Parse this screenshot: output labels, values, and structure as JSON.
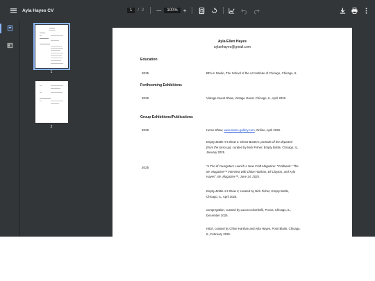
{
  "toolbar": {
    "title": "Ayla Hayes CV",
    "page_current": "1",
    "page_separator": "/",
    "page_total": "2",
    "zoom": "100%",
    "zoom_out": "—",
    "zoom_in": "+"
  },
  "sidebar": {
    "thumbnails": [
      {
        "number": "1",
        "selected": true
      },
      {
        "number": "2",
        "selected": false
      }
    ]
  },
  "document": {
    "name": "Ayla Ellen Hayes",
    "email": "aylaehayes@gmail.com",
    "education": {
      "heading": "Education",
      "entries": [
        {
          "year": "2025",
          "text": "BFA in Studio, The School of the Art Institute of Chicago, Chicago, IL"
        }
      ]
    },
    "forthcoming": {
      "heading": "Forthcoming Exhibitions",
      "entries": [
        {
          "year": "2026",
          "title": "Vintage Guest Show,",
          "text": " Vintage Guest, Chicago, IL, April 2026."
        }
      ]
    },
    "group": {
      "heading": "Group Exhibitions/Publications",
      "year_2026": "2026",
      "year_2025": "2025",
      "entry1": {
        "title": "Horse Show,",
        "link": "www.name-gallery.com",
        "rest": ", Online, April 2026."
      },
      "entry2": {
        "title_line1": "Empty Bottle Art Show 4: Ghost Busters: portraits of the departed",
        "title_line2": "(from the torso up),",
        "rest_line2": " curated by Nick Fisher, Empty Bottle, Chicago, IL,",
        "line3": "January 2025."
      },
      "entry3": {
        "line1": "\"A Trio of Youngsters Launch A New Craft Magazine: \"Craftwerk.\" The",
        "line2": "Mr. Magazine™ Interview with Chloe Harthan, Eli Clayton, and Ayla",
        "line3": "Hayes\", Mr. Magazine™, June 14, 2025."
      },
      "entry4": {
        "title": "Empty Bottle Art Show 3,",
        "rest": " curated by Nick Fisher, Empty Bottle,",
        "line2": "Chicago, IL, April 2025."
      },
      "entry5": {
        "title": "Congregation,",
        "rest": " curated by Lucca Colombelli, Povos, Chicago, IL,",
        "line2": "December 2025."
      },
      "entry6": {
        "title": "Hitch,",
        "rest": " curated by Chloe Harthan and Ayla Hayes, Point Blank, Chicago,",
        "line2": "IL, February 2025."
      }
    }
  },
  "colors": {
    "toolbar_bg": "#323639",
    "viewer_bg": "#525659",
    "accent": "#8ab4f8",
    "link": "#1a4fd6"
  }
}
